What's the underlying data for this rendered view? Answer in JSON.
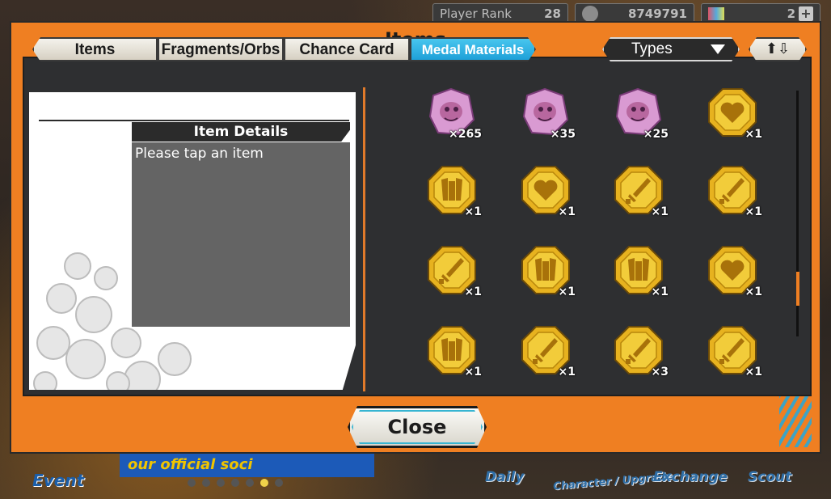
{
  "hud": {
    "rank_label": "Player Rank",
    "rank_value": "28",
    "berries": "8749791",
    "gems": "2",
    "plus": "+"
  },
  "bottom_nav": {
    "event": "Event",
    "banner": "our official soci",
    "daily": "Daily",
    "character": "Character / Upgrade",
    "exchange": "Exchange",
    "scout": "Scout",
    "page_dots": 7,
    "active_dot": 5
  },
  "dialog": {
    "title": "Items",
    "tabs": [
      "Items",
      "Fragments/Orbs",
      "Chance Card",
      "Medal Materials"
    ],
    "active_tab": "Medal Materials",
    "types_label": "Types",
    "sort_label": "⬆⇩",
    "close_label": "Close"
  },
  "details": {
    "header": "Item Details",
    "message": "Please tap an item"
  },
  "medals": [
    {
      "kind": "pink-character",
      "qty": "×265"
    },
    {
      "kind": "pink-character",
      "qty": "×35"
    },
    {
      "kind": "pink-character",
      "qty": "×25"
    },
    {
      "kind": "heart",
      "qty": "×1"
    },
    {
      "kind": "armor",
      "qty": "×1"
    },
    {
      "kind": "heart",
      "qty": "×1"
    },
    {
      "kind": "sword",
      "qty": "×1"
    },
    {
      "kind": "sword",
      "qty": "×1"
    },
    {
      "kind": "sword",
      "qty": "×1"
    },
    {
      "kind": "armor",
      "qty": "×1"
    },
    {
      "kind": "armor",
      "qty": "×1"
    },
    {
      "kind": "heart",
      "qty": "×1"
    },
    {
      "kind": "armor",
      "qty": "×1"
    },
    {
      "kind": "sword",
      "qty": "×1"
    },
    {
      "kind": "sword",
      "qty": "×3"
    },
    {
      "kind": "sword",
      "qty": "×1"
    }
  ],
  "colors": {
    "dialog_orange": "#ef7f22",
    "tab_active": "#1ea0d8",
    "medal_gold": "#e7b21f",
    "medal_pink": "#d99ad2"
  }
}
